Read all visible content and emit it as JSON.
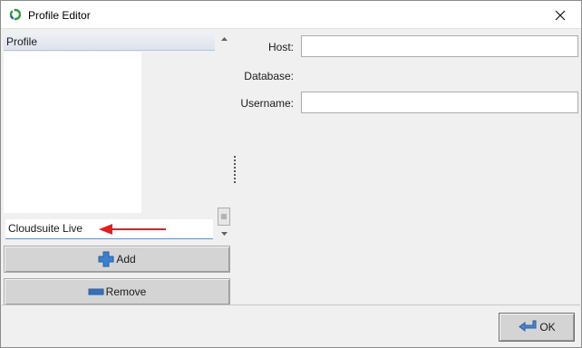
{
  "window": {
    "title": "Profile Editor",
    "icon": "refresh-ring-icon",
    "close_icon": "close-icon"
  },
  "profile_list": {
    "header": "Profile",
    "items": [],
    "selected_item": "Cloudsuite Live"
  },
  "buttons": {
    "add_label": "Add",
    "remove_label": "Remove",
    "ok_label": "OK"
  },
  "form": {
    "host_label": "Host:",
    "host_value": "",
    "database_label": "Database:",
    "username_label": "Username:",
    "username_value": ""
  },
  "colors": {
    "arrow": "#e02020",
    "add_icon": "#3a7fd0",
    "remove_icon": "#3a6fb8"
  }
}
